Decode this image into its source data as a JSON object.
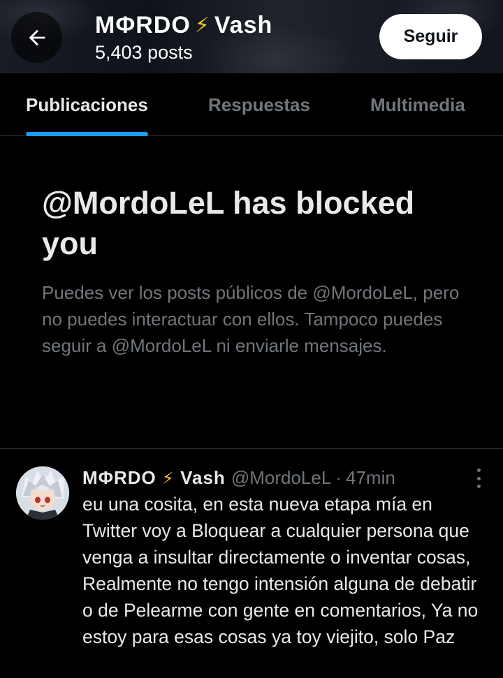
{
  "header": {
    "name_part1": "MΦRDO",
    "name_part2": "Vash",
    "posts": "5,403 posts",
    "follow_label": "Seguir",
    "accent_colors": {
      "bolt": "#f5c518"
    }
  },
  "tabs": [
    {
      "label": "Publicaciones",
      "active": true
    },
    {
      "label": "Respuestas",
      "active": false
    },
    {
      "label": "Multimedia",
      "active": false
    }
  ],
  "blocked": {
    "title": "@MordoLeL has blocked you",
    "message": "Puedes ver los posts públicos de @MordoLeL, pero no puedes interactuar con ellos. Tampoco puedes seguir a @MordoLeL ni enviarle mensajes."
  },
  "tweet": {
    "name_part1": "MΦRDO",
    "name_part2": "Vash",
    "handle": "@MordoLeL",
    "separator": "·",
    "time": "47min",
    "text": "eu una cosita, en esta nueva etapa mía en Twitter voy a  Bloquear a cualquier persona que venga a insultar directamente o inventar cosas, Realmente no tengo intensión alguna de debatir o de Pelearme con gente en comentarios, Ya no estoy para esas cosas ya toy viejito, solo Paz"
  },
  "colors": {
    "background": "#000000",
    "text": "#e7e9ea",
    "muted": "#71767b",
    "accent": "#1d9bf0"
  }
}
